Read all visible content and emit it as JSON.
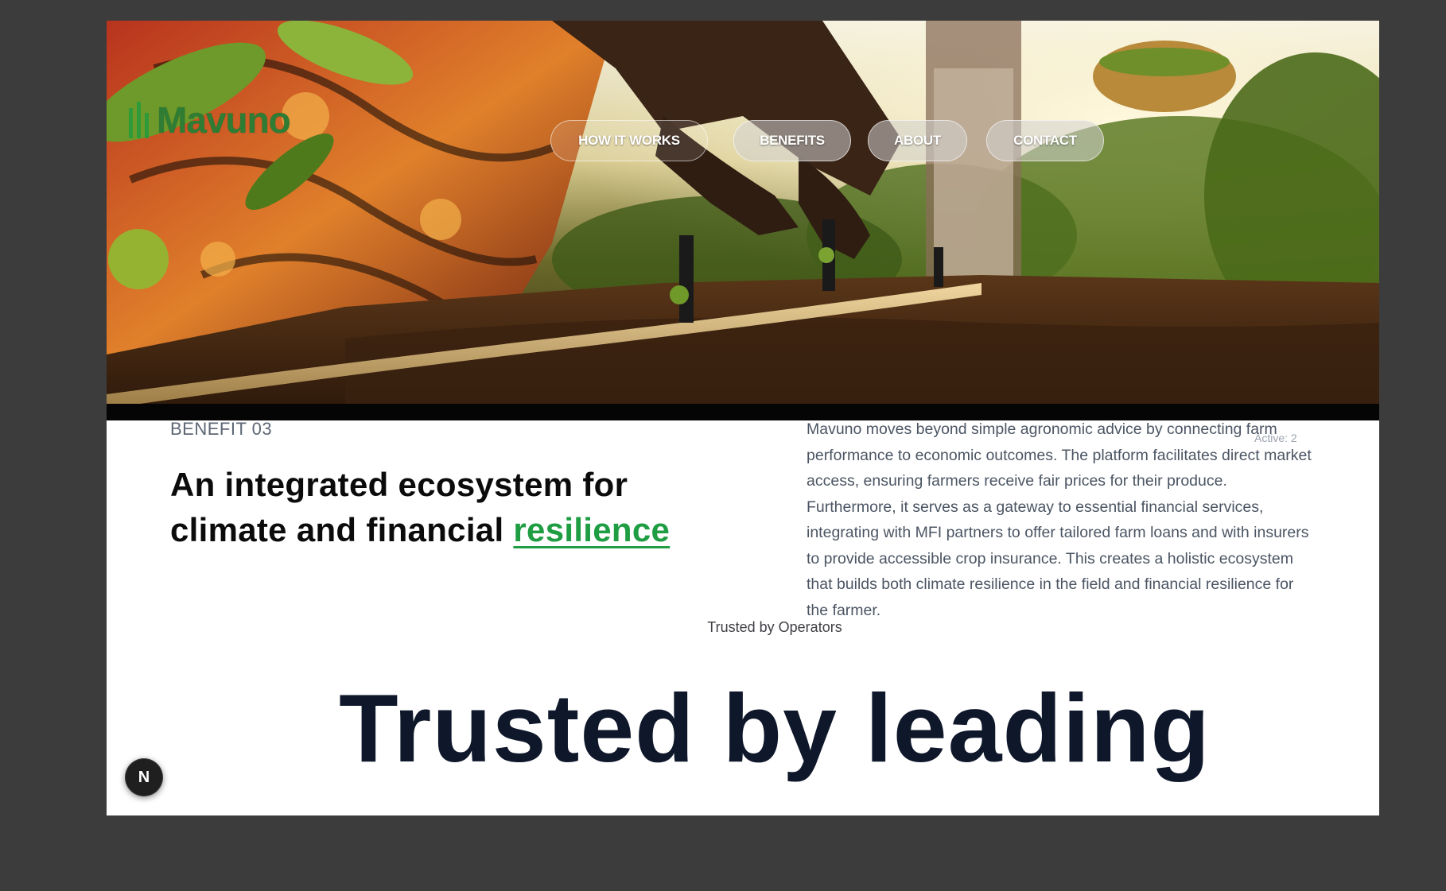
{
  "brand": {
    "name": "Mavuno",
    "color": "#2f7d34"
  },
  "nav": {
    "items": [
      {
        "label": "HOW IT WORKS"
      },
      {
        "label": "BENEFITS"
      },
      {
        "label": "ABOUT"
      },
      {
        "label": "CONTACT"
      }
    ]
  },
  "benefit": {
    "eyebrow": "BENEFIT 03",
    "headline_main": "An integrated ecosystem for climate and financial ",
    "headline_accent": "resilience",
    "accent_color": "#1f9d43",
    "body": "Mavuno moves beyond simple agronomic advice by connecting farm performance to economic outcomes. The platform facilitates direct market access, ensuring farmers receive fair prices for their produce. Furthermore, it serves as a gateway to essential financial services, integrating with MFI partners to offer tailored farm loans and with insurers to provide accessible crop insurance. This creates a holistic ecosystem that builds both climate resilience in the field and financial resilience for the farmer.",
    "active_indicator": "Active: 2"
  },
  "trusted": {
    "caption": "Trusted by Operators",
    "heading": "Trusted by leading"
  },
  "dev_badge": {
    "label": "N"
  }
}
